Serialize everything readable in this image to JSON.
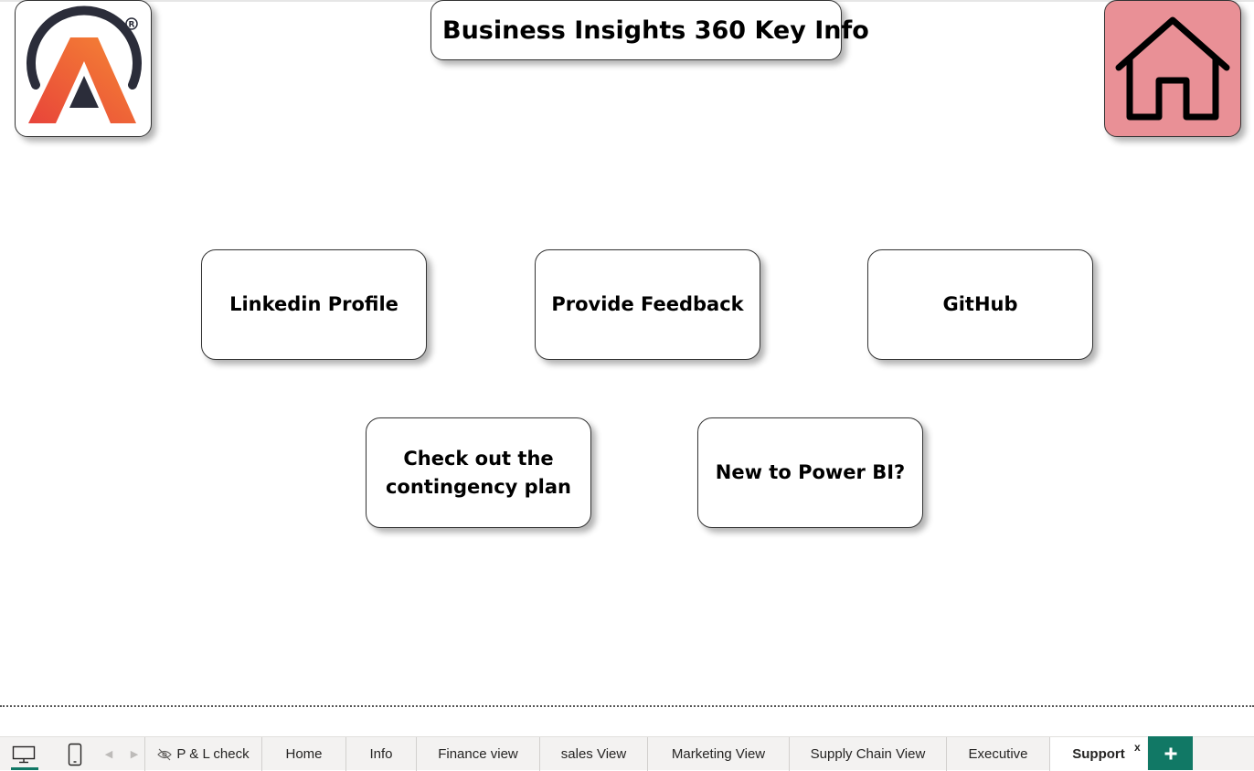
{
  "report": {
    "title": "Business Insights 360 Key Info"
  },
  "logo": {
    "trademark": "®"
  },
  "home_button": {
    "icon": "home-icon",
    "background": "#E99096"
  },
  "link_buttons": [
    {
      "label": "Linkedin Profile"
    },
    {
      "label": "Provide Feedback"
    },
    {
      "label": "GitHub"
    },
    {
      "label": "Check out the contingency plan"
    },
    {
      "label": "New to Power BI?"
    }
  ],
  "page_tabs": {
    "view_icons": [
      "desktop-icon",
      "phone-icon"
    ],
    "nav_icons": [
      "chevron-left-icon",
      "chevron-right-icon"
    ],
    "tabs": [
      {
        "label": "P & L check",
        "hidden_icon": "eye-slash-icon"
      },
      {
        "label": "Home"
      },
      {
        "label": "Info"
      },
      {
        "label": "Finance view"
      },
      {
        "label": "sales View"
      },
      {
        "label": "Marketing View"
      },
      {
        "label": "Supply Chain View"
      },
      {
        "label": "Executive"
      },
      {
        "label": "Support",
        "active": true
      }
    ],
    "close_label": "x",
    "add_icon": "plus-icon",
    "accent": "#117865"
  },
  "colors": {
    "logo_dark": "#2B2D3A",
    "logo_gradient_start": "#E8443A",
    "logo_gradient_end": "#F58634"
  }
}
